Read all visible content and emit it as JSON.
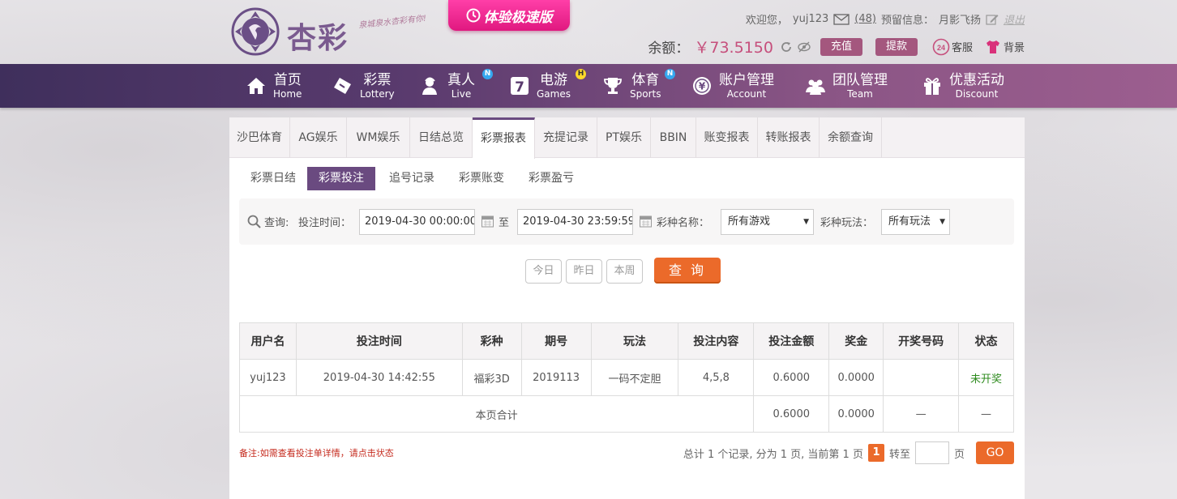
{
  "brand": {
    "name": "杏彩",
    "slogan": "泉城泉水杏彩有你!"
  },
  "speed_button": "体验极速版",
  "user": {
    "welcome": "欢迎您，",
    "username": "yuj123",
    "messages": "(48)",
    "reserve_label": "预留信息：",
    "reserve_value": "月影飞扬",
    "logout": "退出"
  },
  "balance": {
    "label": "余额：",
    "value": "￥73.5150"
  },
  "actions": {
    "deposit": "充值",
    "withdraw": "提款",
    "service": "客服",
    "skin": "背景"
  },
  "nav": [
    {
      "zh": "首页",
      "en": "Home",
      "icon": "home-icon"
    },
    {
      "zh": "彩票",
      "en": "Lottery",
      "icon": "lottery-ticket-icon"
    },
    {
      "zh": "真人",
      "en": "Live",
      "icon": "dealer-icon",
      "badge": "N"
    },
    {
      "zh": "电游",
      "en": "Games",
      "icon": "slot-seven-icon",
      "badge": "H"
    },
    {
      "zh": "体育",
      "en": "Sports",
      "icon": "trophy-icon",
      "badge": "N"
    },
    {
      "zh": "账户管理",
      "en": "Account",
      "icon": "yen-coin-icon"
    },
    {
      "zh": "团队管理",
      "en": "Team",
      "icon": "team-icon"
    },
    {
      "zh": "优惠活动",
      "en": "Discount",
      "icon": "gift-icon"
    }
  ],
  "tabs": [
    "沙巴体育",
    "AG娱乐",
    "WM娱乐",
    "日结总览",
    "彩票报表",
    "充提记录",
    "PT娱乐",
    "BBIN",
    "账变报表",
    "转账报表",
    "余额查询"
  ],
  "subtabs": [
    "彩票日结",
    "彩票投注",
    "追号记录",
    "彩票账变",
    "彩票盈亏"
  ],
  "filter": {
    "query_label": "查询:",
    "time_label": "投注时间：",
    "start": "2019-04-30 00:00:00",
    "to": "至",
    "end": "2019-04-30 23:59:59",
    "game_label": "彩种名称：",
    "game_value": "所有游戏",
    "play_label": "彩种玩法：",
    "play_value": "所有玩法"
  },
  "quick": {
    "today": "今日",
    "yesterday": "昨日",
    "week": "本周",
    "search": "查 询"
  },
  "table": {
    "headers": [
      "用户名",
      "投注时间",
      "彩种",
      "期号",
      "玩法",
      "投注内容",
      "投注金额",
      "奖金",
      "开奖号码",
      "状态"
    ],
    "rows": [
      [
        "yuj123",
        "2019-04-30 14:42:55",
        "福彩3D",
        "2019113",
        "一码不定胆",
        "4,5,8",
        "0.6000",
        "0.0000",
        "",
        "未开奖"
      ]
    ],
    "total": {
      "label": "本页合计",
      "amount": "0.6000",
      "bonus": "0.0000",
      "numbers": "—",
      "status": "—"
    }
  },
  "note": "备注:如需查看投注单详情，请点击状态",
  "pager": {
    "summary": "总计 1 个记录, 分为 1 页, 当前第 1 页",
    "current": "1",
    "goto_label": "转至",
    "page_unit": "页",
    "go": "GO"
  }
}
